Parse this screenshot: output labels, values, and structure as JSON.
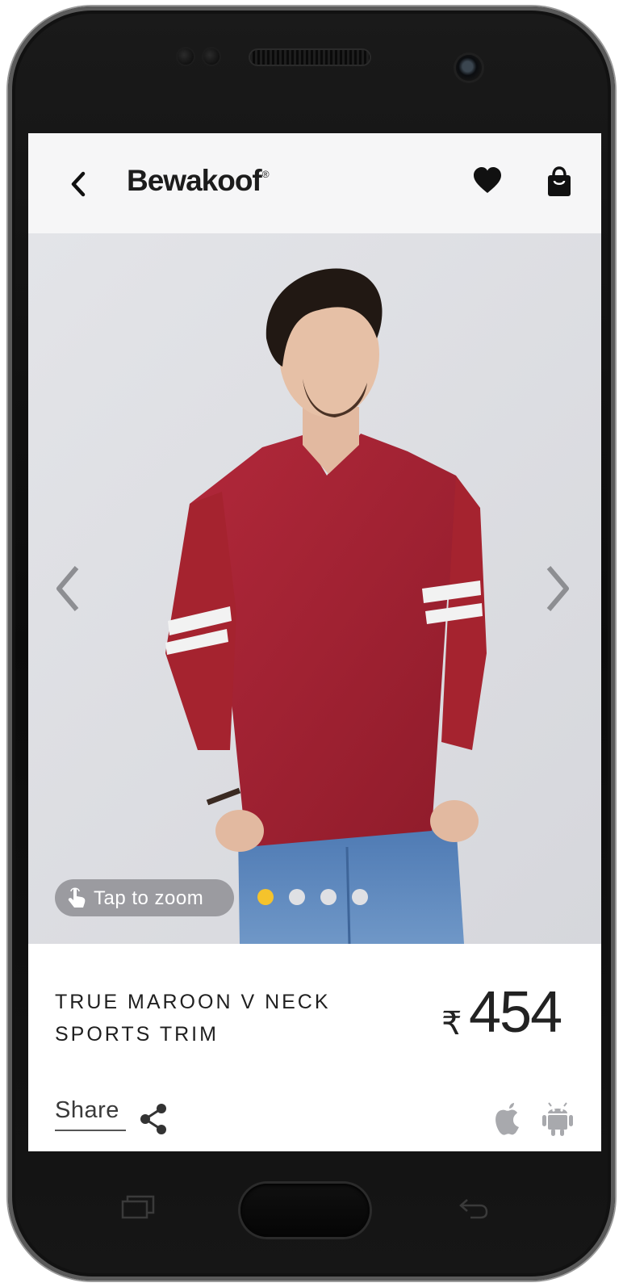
{
  "app": {
    "brand": "Bewakoof",
    "brand_mark": "®"
  },
  "header": {
    "back_icon": "chevron-left-icon",
    "wishlist_icon": "heart-icon",
    "bag_icon": "shopping-bag-icon"
  },
  "gallery": {
    "zoom_label": "Tap to zoom",
    "zoom_icon": "tap-hand-icon",
    "active_index": 1,
    "total_images": 4,
    "dot_colors": {
      "active": "#f5c32c",
      "inactive": "#dfe0e4"
    },
    "prev_icon": "chevron-left-icon",
    "next_icon": "chevron-right-icon"
  },
  "product": {
    "title_line1": "TRUE MAROON V NECK",
    "title_line2": "SPORTS TRIM",
    "currency": "₹",
    "price": "454",
    "shirt_color": "#a0202e"
  },
  "footer": {
    "share_label": "Share",
    "share_icon": "share-icon",
    "platform_icons": [
      "apple-icon",
      "android-icon"
    ]
  }
}
